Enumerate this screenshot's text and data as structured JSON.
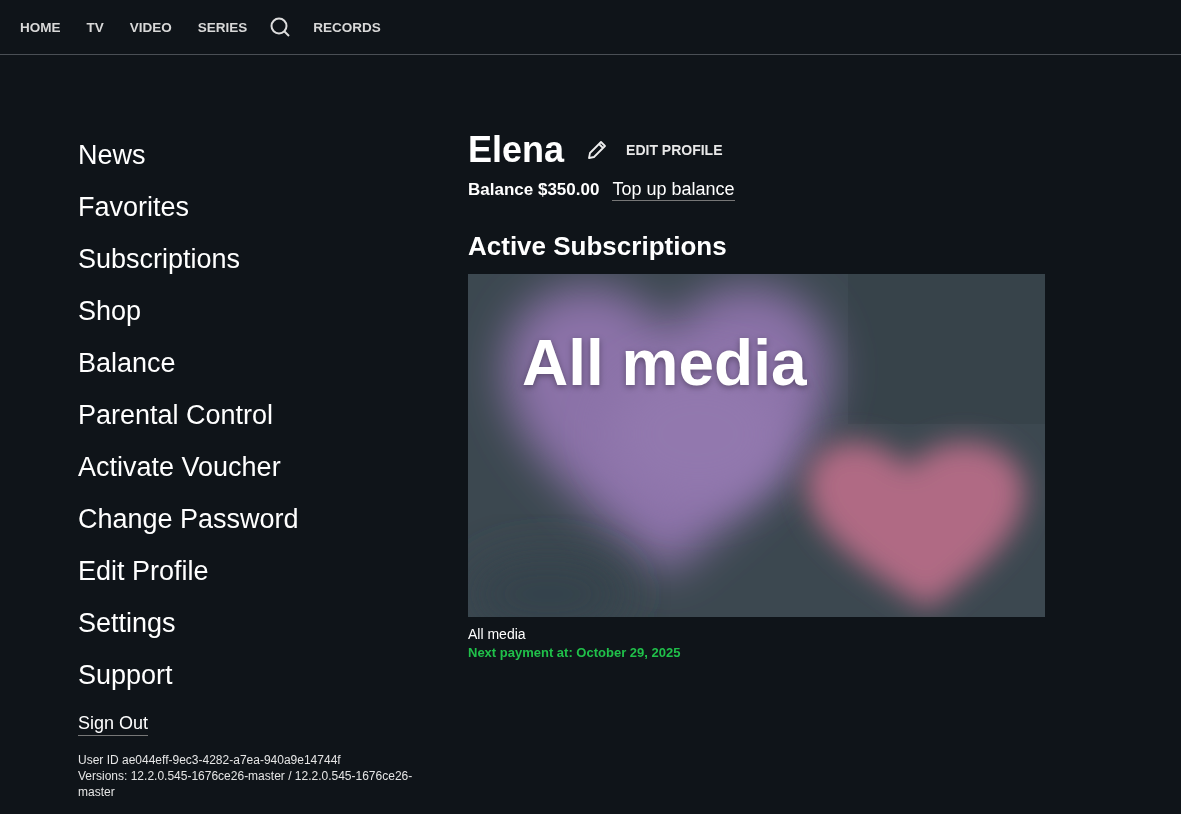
{
  "nav": [
    {
      "label": "HOME",
      "kind": "link"
    },
    {
      "label": "TV",
      "kind": "link"
    },
    {
      "label": "VIDEO",
      "kind": "link"
    },
    {
      "label": "SERIES",
      "kind": "link"
    },
    {
      "kind": "search"
    },
    {
      "label": "RECORDS",
      "kind": "link"
    }
  ],
  "menu": [
    "News",
    "Favorites",
    "Subscriptions",
    "Shop",
    "Balance",
    "Parental Control",
    "Activate Voucher",
    "Change Password",
    "Edit Profile",
    "Settings",
    "Support"
  ],
  "sign_out": "Sign Out",
  "user_id": "User ID ae044eff-9ec3-4282-a7ea-940a9e14744f",
  "versions": "Versions: 12.2.0.545-1676ce26-master / 12.2.0.545-1676ce26-master",
  "profile": {
    "name": "Elena",
    "edit_label": "EDIT PROFILE",
    "balance": "Balance $350.00",
    "top_up": "Top up balance"
  },
  "section_title": "Active Subscriptions",
  "subscriptions": [
    {
      "banner_title": "All media",
      "name": "All media",
      "next_payment": "Next payment at: October 29, 2025"
    }
  ]
}
